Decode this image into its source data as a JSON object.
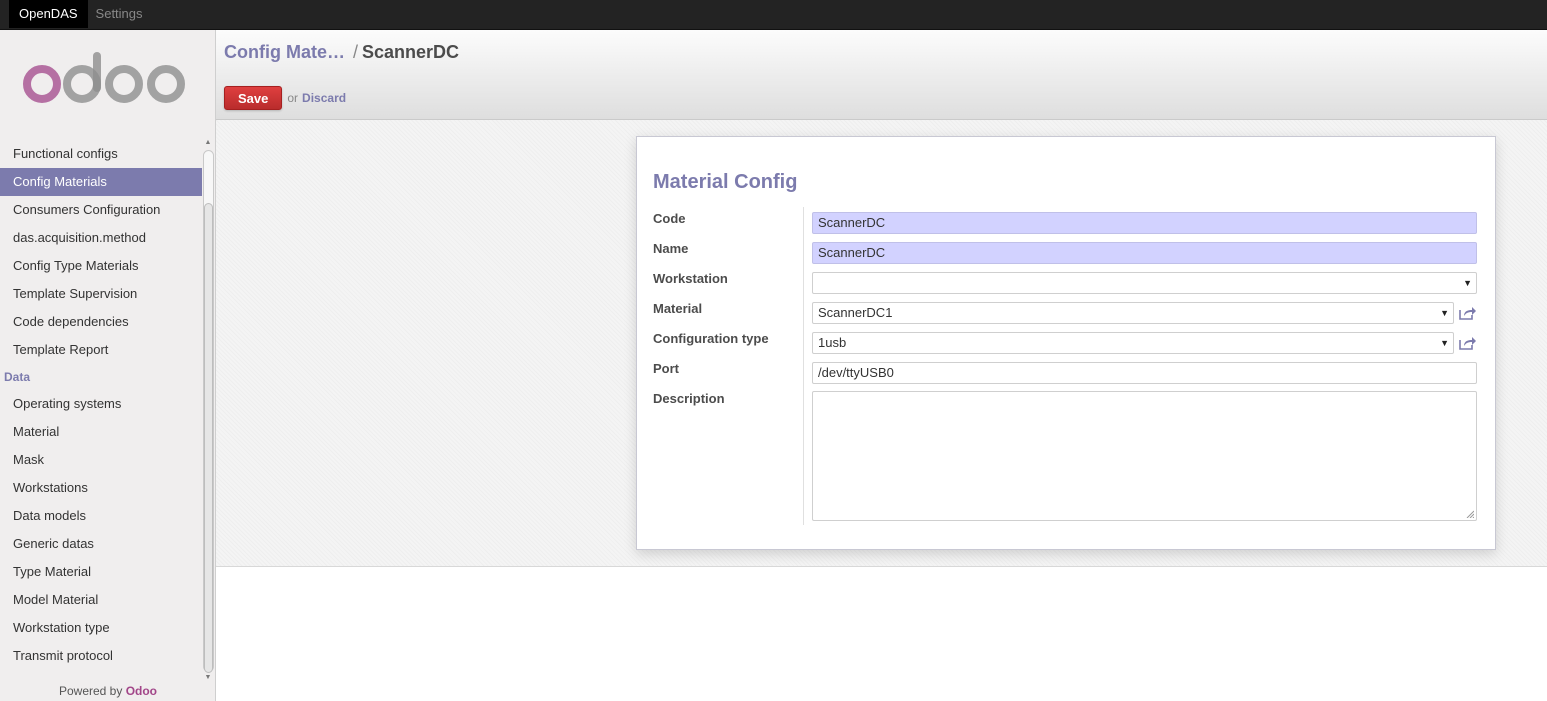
{
  "topbar": {
    "items": [
      {
        "label": "OpenDAS",
        "active": true
      },
      {
        "label": "Settings",
        "active": false
      }
    ]
  },
  "sidebar": {
    "logo_text": "odoo",
    "items": [
      {
        "label": "Functional configs",
        "type": "item"
      },
      {
        "label": "Config Materials",
        "type": "item",
        "active": true
      },
      {
        "label": "Consumers Configuration",
        "type": "item"
      },
      {
        "label": "das.acquisition.method",
        "type": "item"
      },
      {
        "label": "Config Type Materials",
        "type": "item"
      },
      {
        "label": "Template Supervision",
        "type": "item"
      },
      {
        "label": "Code dependencies",
        "type": "item"
      },
      {
        "label": "Template Report",
        "type": "item"
      },
      {
        "label": "Data",
        "type": "section"
      },
      {
        "label": "Operating systems",
        "type": "item"
      },
      {
        "label": "Material",
        "type": "item"
      },
      {
        "label": "Mask",
        "type": "item"
      },
      {
        "label": "Workstations",
        "type": "item"
      },
      {
        "label": "Data models",
        "type": "item"
      },
      {
        "label": "Generic datas",
        "type": "item"
      },
      {
        "label": "Type Material",
        "type": "item"
      },
      {
        "label": "Model Material",
        "type": "item"
      },
      {
        "label": "Workstation type",
        "type": "item"
      },
      {
        "label": "Transmit protocol",
        "type": "item"
      }
    ],
    "powered_prefix": "Powered by",
    "powered_brand": "Odoo"
  },
  "header": {
    "breadcrumb_parent": "Config Mate…",
    "breadcrumb_sep": "/",
    "breadcrumb_current": "ScannerDC",
    "save_label": "Save",
    "or_text": "or",
    "discard_label": "Discard"
  },
  "form": {
    "title": "Material Config",
    "fields": {
      "code": {
        "label": "Code",
        "value": "ScannerDC"
      },
      "name": {
        "label": "Name",
        "value": "ScannerDC"
      },
      "workstation": {
        "label": "Workstation",
        "value": ""
      },
      "material": {
        "label": "Material",
        "value": "ScannerDC1"
      },
      "configuration_type": {
        "label": "Configuration type",
        "value": "1usb"
      },
      "port": {
        "label": "Port",
        "value": "/dev/ttyUSB0"
      },
      "description": {
        "label": "Description",
        "value": ""
      }
    }
  },
  "colors": {
    "accent": "#7c7bad",
    "save_button": "#c9302c",
    "required_field": "#d2d2ff",
    "brand": "#a24689"
  }
}
